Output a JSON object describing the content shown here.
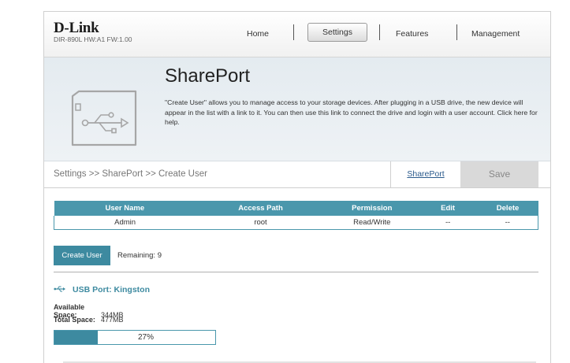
{
  "brand": {
    "logo": "D-Link",
    "model_info": "DIR-890L  HW:A1  FW:1.00"
  },
  "nav": {
    "home": "Home",
    "settings": "Settings",
    "features": "Features",
    "management": "Management"
  },
  "hero": {
    "title": "SharePort",
    "description": "\"Create User\" allows you to manage access to your storage devices. After plugging in a USB drive, the new device will appear in the list with a link to it. You can then use this link to connect the drive and login with a user account. Click here for help."
  },
  "breadcrumb": "Settings >> SharePort >> Create User",
  "actions": {
    "shareport_link": "SharePort",
    "save": "Save"
  },
  "users_table": {
    "headers": [
      "User Name",
      "Access Path",
      "Permission",
      "Edit",
      "Delete"
    ],
    "rows": [
      {
        "user": "Admin",
        "path": "root",
        "permission": "Read/Write",
        "edit": "--",
        "delete": "--"
      }
    ]
  },
  "create_user": {
    "button": "Create User",
    "remaining": "Remaining: 9"
  },
  "usb": {
    "port_label": "USB Port: Kingston",
    "available_label": "Available Space:",
    "available_value": "344MB",
    "total_label": "Total Space:",
    "total_value": "477MB",
    "usage_percent_text": "27%",
    "usage_fraction": 0.27
  },
  "colors": {
    "accent": "#3d8aa0",
    "header_bg": "#4a97ac",
    "link": "#2a5a8c"
  },
  "icons": {
    "hero": "usb-icon",
    "port": "usb-small-icon"
  }
}
